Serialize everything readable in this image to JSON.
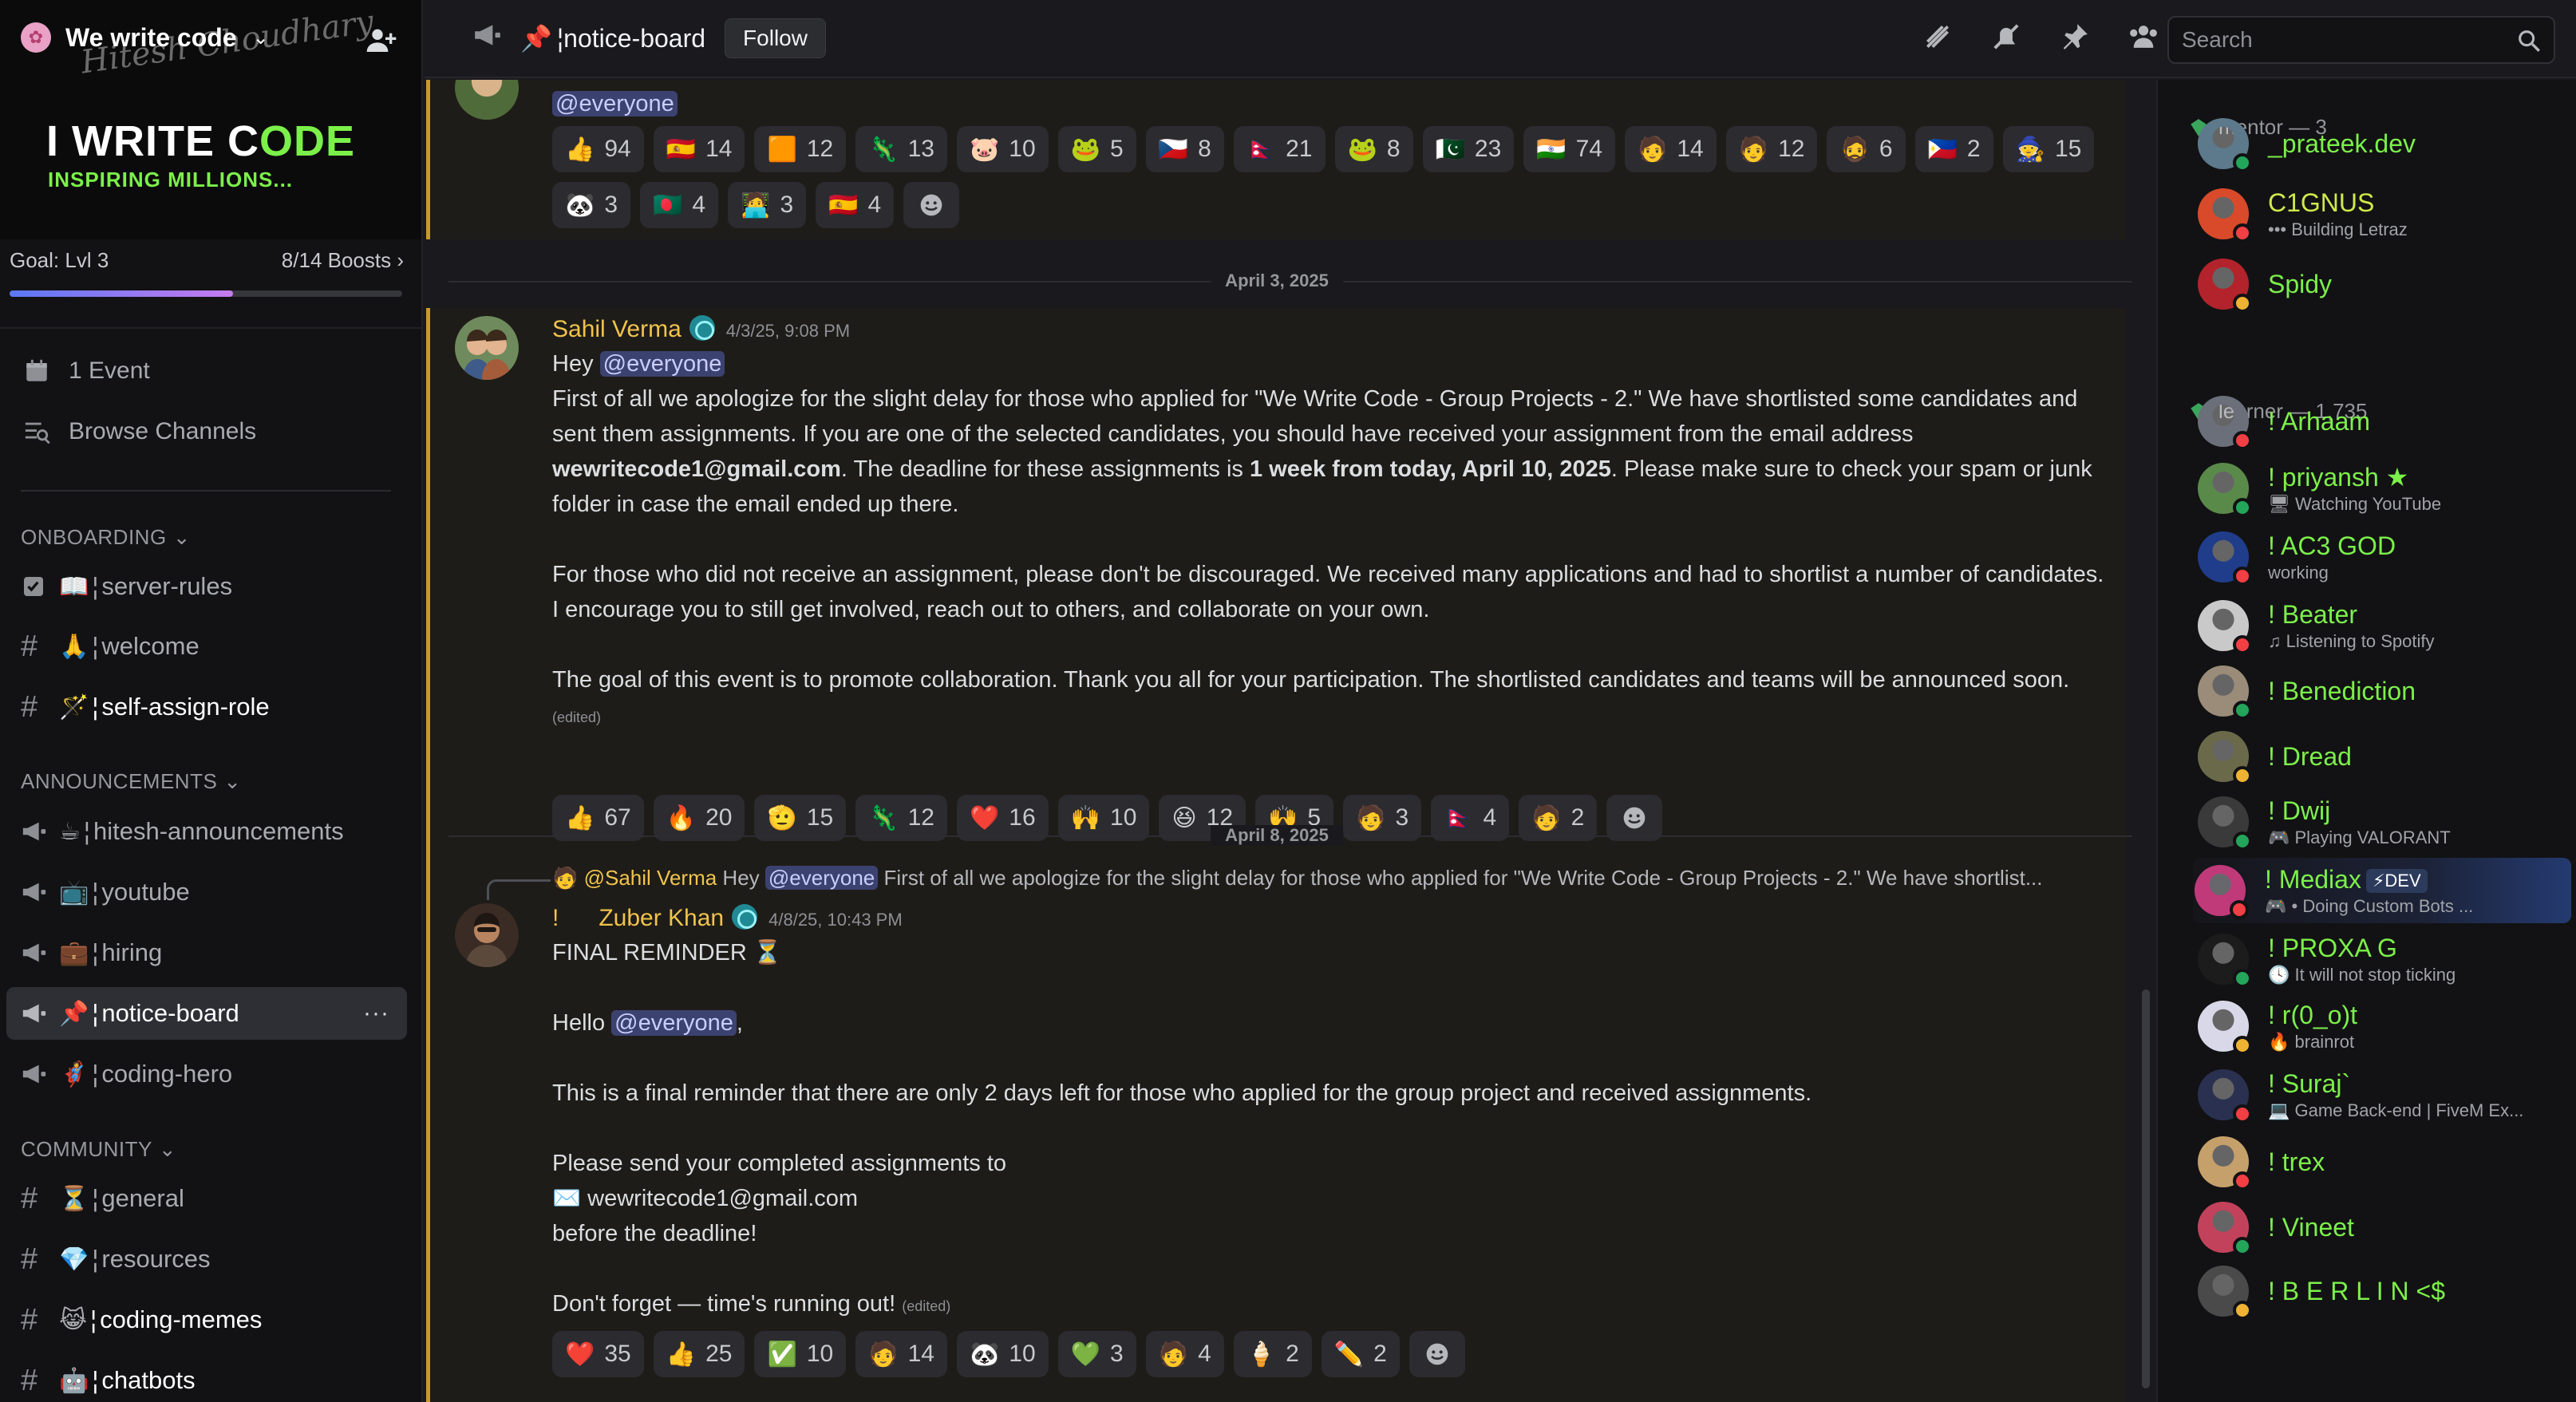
{
  "server": {
    "name": "We write code",
    "banner_title_white": "I WRITE C",
    "banner_title_accent": "ODE",
    "banner_subtitle": "INSPIRING MILLIONS...",
    "banner_signature": "Hitesh Choudhary",
    "boost_goal": "Goal: Lvl 3",
    "boost_count": "8/14 Boosts",
    "boost_progress": 0.57
  },
  "sidebar": {
    "utility": [
      {
        "label": "1 Event",
        "icon": "calendar-icon"
      },
      {
        "label": "Browse Channels",
        "icon": "browse-channels-icon"
      }
    ],
    "categories": [
      {
        "label": "ONBOARDING",
        "channels": [
          {
            "icon": "rules-icon",
            "emoji": "📖",
            "name": "server-rules"
          },
          {
            "icon": "hash-icon",
            "emoji": "🙏",
            "name": "welcome"
          },
          {
            "icon": "hash-icon",
            "emoji": "🪄",
            "name": "self-assign-role"
          }
        ]
      },
      {
        "label": "ANNOUNCEMENTS",
        "channels": [
          {
            "icon": "megaphone-icon",
            "emoji": "☕",
            "name": "hitesh-announcements"
          },
          {
            "icon": "megaphone-icon",
            "emoji": "📺",
            "name": "youtube"
          },
          {
            "icon": "megaphone-icon",
            "emoji": "💼",
            "name": "hiring"
          },
          {
            "icon": "megaphone-icon",
            "emoji": "📌",
            "name": "notice-board"
          },
          {
            "icon": "megaphone-icon",
            "emoji": "🦸",
            "name": "coding-hero"
          }
        ]
      },
      {
        "label": "COMMUNITY",
        "channels": [
          {
            "icon": "hash-icon",
            "emoji": "⏳",
            "name": "general"
          },
          {
            "icon": "hash-icon",
            "emoji": "💎",
            "name": "resources"
          },
          {
            "icon": "hash-icon",
            "emoji": "😹",
            "name": "coding-memes"
          },
          {
            "icon": "hash-icon",
            "emoji": "🤖",
            "name": "chatbots"
          }
        ]
      }
    ],
    "active_more": "···"
  },
  "header": {
    "channel_emoji": "📌",
    "channel_name": "notice-board",
    "follow_label": "Follow",
    "search_placeholder": "Search",
    "icons": [
      "threads-icon",
      "mute-icon",
      "pin-icon",
      "member-list-icon"
    ]
  },
  "chat": {
    "prev_message": {
      "mention": "@everyone",
      "reactions_row1": [
        {
          "e": "👍",
          "c": "94"
        },
        {
          "e": "🇪🇸",
          "c": "14"
        },
        {
          "e": "🟧",
          "c": "12"
        },
        {
          "e": "🦎",
          "c": "13"
        },
        {
          "e": "🐷",
          "c": "10"
        },
        {
          "e": "🐸",
          "c": "5"
        },
        {
          "e": "🇨🇿",
          "c": "8"
        },
        {
          "e": "🇳🇵",
          "c": "21"
        },
        {
          "e": "🐸",
          "c": "8"
        },
        {
          "e": "🇵🇰",
          "c": "23"
        },
        {
          "e": "🇮🇳",
          "c": "74"
        },
        {
          "e": "🧑",
          "c": "14"
        },
        {
          "e": "🧑",
          "c": "12"
        },
        {
          "e": "🧔",
          "c": "6"
        },
        {
          "e": "🇵🇭",
          "c": "2"
        },
        {
          "e": "🧙",
          "c": "15"
        }
      ],
      "reactions_row2": [
        {
          "e": "🐼",
          "c": "3"
        },
        {
          "e": "🇧🇩",
          "c": "4"
        },
        {
          "e": "🧑‍💻",
          "c": "3"
        },
        {
          "e": "🇪🇸",
          "c": "4"
        }
      ]
    },
    "date1": "April 3, 2025",
    "msg1": {
      "author": "Sahil Verma",
      "timestamp": "4/3/25, 9:08 PM",
      "greeting": "Hey ",
      "mention": "@everyone",
      "p1_a": "First of all we apologize for the slight delay for those who applied for \"We Write Code - Group Projects - 2.\" We have shortlisted some candidates and sent them assignments. If you are one of the selected candidates, you should have received your assignment from the email address ",
      "p1_email": "wewritecode1@gmail.com",
      "p1_b": ". The deadline for these assignments is ",
      "p1_deadline": "1 week from today, April 10, 2025",
      "p1_c": ". Please make sure to check your spam or junk folder in case the email ended up there.",
      "p2": "For those who did not receive an assignment, please don't be discouraged. We received many applications and had to shortlist a number of candidates. I encourage you to still get involved, reach out to others, and collaborate on your own.",
      "p3": "The goal of this event is to promote collaboration. Thank you all for your participation. The shortlisted candidates and teams will be announced soon.",
      "edited": "(edited)",
      "reactions": [
        {
          "e": "👍",
          "c": "67"
        },
        {
          "e": "🔥",
          "c": "20"
        },
        {
          "e": "🫡",
          "c": "15"
        },
        {
          "e": "🦎",
          "c": "12"
        },
        {
          "e": "❤️",
          "c": "16"
        },
        {
          "e": "🙌",
          "c": "10"
        },
        {
          "e": "😆",
          "c": "12"
        },
        {
          "e": "🙌",
          "c": "5"
        },
        {
          "e": "🧑",
          "c": "3"
        },
        {
          "e": "🇳🇵",
          "c": "4"
        },
        {
          "e": "🧑",
          "c": "2"
        }
      ]
    },
    "date2": "April 8, 2025",
    "msg2": {
      "reply_author": "@Sahil Verma",
      "reply_hey": "Hey",
      "reply_mention": "@everyone",
      "reply_text": "First of all we apologize for the slight delay for those who applied for \"We Write Code - Group Projects - 2.\" We have shortlist...",
      "prefix": "!",
      "author": "Zuber Khan",
      "timestamp": "4/8/25, 10:43 PM",
      "line1": "FINAL REMINDER ⏳",
      "hello": "Hello ",
      "mention": "@everyone",
      "hello_end": ",",
      "line3": "This is a final reminder that there are only 2 days left for those who applied for the group project and received assignments.",
      "line4": "Please send your completed assignments to",
      "line5": "✉️ wewritecode1@gmail.com",
      "line6": "before the deadline!",
      "line7": "Don't forget — time's running out!",
      "edited": "(edited)",
      "reactions": [
        {
          "e": "❤️",
          "c": "35"
        },
        {
          "e": "👍",
          "c": "25"
        },
        {
          "e": "✅",
          "c": "10"
        },
        {
          "e": "🧑",
          "c": "14"
        },
        {
          "e": "🐼",
          "c": "10"
        },
        {
          "e": "💚",
          "c": "3"
        },
        {
          "e": "🧑",
          "c": "4"
        },
        {
          "e": "🍦",
          "c": "2"
        },
        {
          "e": "✏️",
          "c": "2"
        }
      ]
    }
  },
  "members": {
    "groups": [
      {
        "label": "mentor — 3",
        "items": [
          {
            "name": "_prateek.dev",
            "activity": "",
            "status": "on",
            "color": "#5d7a8c"
          },
          {
            "name": "C1GNUS",
            "activity": "••• Building Letraz",
            "status": "dnd",
            "color": "#d94a2a",
            "name_color": "yel"
          },
          {
            "name": "Spidy",
            "activity": "",
            "status": "idle",
            "color": "#b3232b"
          }
        ]
      },
      {
        "label": "learner — 1,735",
        "items": [
          {
            "name": "! Arhaam",
            "activity": "",
            "status": "dnd",
            "color": "#6b6f7a"
          },
          {
            "name": "! priyansh ★",
            "activity": "🖥 Watching YouTube",
            "status": "on",
            "color": "#5a8a4a"
          },
          {
            "name": "! AC3 GOD",
            "activity": "working",
            "status": "dnd",
            "color": "#1f3d8a"
          },
          {
            "name": "! Beater",
            "activity": "♫ Listening to Spotify",
            "status": "dnd",
            "color": "#c9c9c9"
          },
          {
            "name": "! Benediction",
            "activity": "",
            "status": "on",
            "color": "#9a8c78"
          },
          {
            "name": "! Dread",
            "activity": "",
            "status": "idle",
            "color": "#6a6a4a"
          },
          {
            "name": "! Dwij",
            "activity": "🎮 Playing VALORANT",
            "status": "on",
            "color": "#3a3a3a"
          },
          {
            "name": "! Mediax",
            "badge": "⚡DEV",
            "activity": "🎮 • Doing Custom Bots ...",
            "status": "dnd",
            "color": "#c03a7a"
          },
          {
            "name": "! PROXA G",
            "activity": "🕓 It will not stop ticking",
            "status": "on",
            "color": "#1c1c1c"
          },
          {
            "name": "! r(0_o)t",
            "activity": "🔥 brainrot",
            "status": "idle",
            "color": "#d8d8e8"
          },
          {
            "name": "! Suraj`",
            "activity": "💻 Game Back-end | FiveM Ex...",
            "status": "dnd",
            "color": "#2a3050"
          },
          {
            "name": "! trex",
            "activity": "",
            "status": "dnd",
            "color": "#c6a06a"
          },
          {
            "name": "! Vineet",
            "activity": "",
            "status": "on",
            "color": "#c2425c"
          },
          {
            "name": "! B E R L I N <$",
            "activity": "",
            "status": "idle",
            "color": "#4a4a4a"
          }
        ]
      }
    ]
  }
}
